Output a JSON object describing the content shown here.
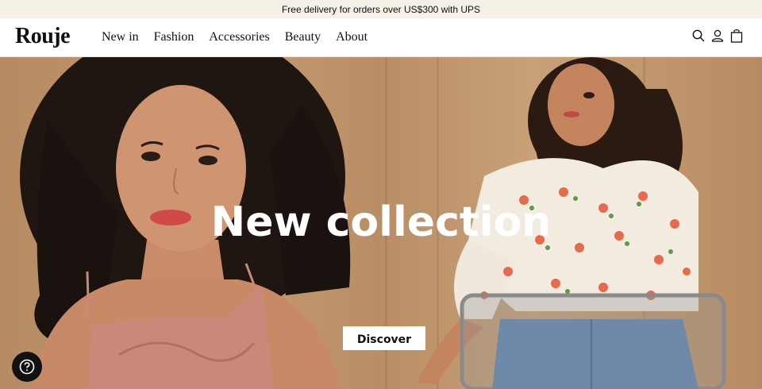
{
  "announcement": {
    "text": "Free delivery for orders over US$300 with UPS"
  },
  "header": {
    "logo": "Rouje",
    "nav": [
      {
        "label": "New in"
      },
      {
        "label": "Fashion"
      },
      {
        "label": "Accessories"
      },
      {
        "label": "Beauty"
      },
      {
        "label": "About"
      }
    ],
    "icons": [
      "search-icon",
      "account-icon",
      "bag-icon"
    ]
  },
  "hero": {
    "title": "New collection",
    "cta_label": "Discover"
  },
  "help": {
    "icon": "question-mark-icon"
  },
  "colors": {
    "announcement_bg": "#f4f0e6",
    "text": "#111111",
    "hero_bg": "#c49a70",
    "white": "#ffffff"
  }
}
